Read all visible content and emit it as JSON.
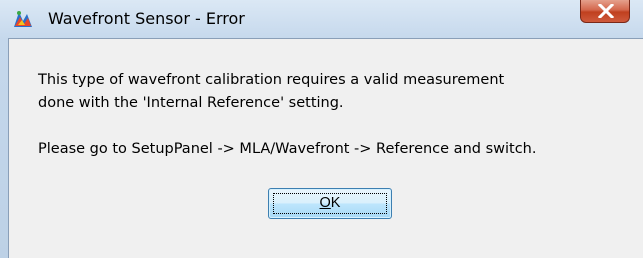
{
  "window": {
    "title": "Wavefront Sensor - Error",
    "app_icon": "wavefront-app-icon",
    "close_icon": "close-x-icon"
  },
  "message": {
    "line1": "This type of wavefront calibration requires a valid measurement",
    "line2": "done with the 'Internal Reference' setting.",
    "line3": "Please go to SetupPanel -> MLA/Wavefront -> Reference and switch."
  },
  "buttons": {
    "ok_label": "OK",
    "ok_mnemonic": "O"
  },
  "colors": {
    "close_button": "#c7472a",
    "ok_button_border": "#3c7fb1"
  }
}
